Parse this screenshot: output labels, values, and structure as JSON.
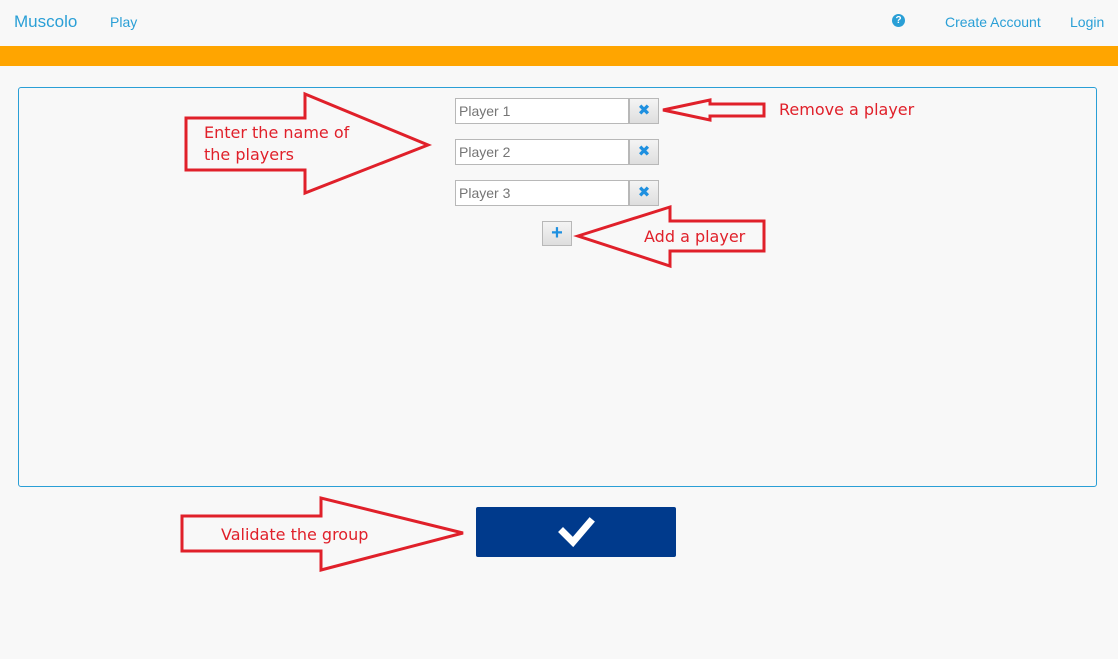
{
  "navbar": {
    "brand": "Muscolo",
    "play": "Play",
    "help_icon": "question-circle-icon",
    "create_account": "Create Account",
    "login": "Login"
  },
  "colors": {
    "accent": "#2a9fd6",
    "orange_bar": "#ffa500",
    "validate_button": "#003a8c",
    "annotation": "#e0202a"
  },
  "players": [
    {
      "placeholder": "Player 1"
    },
    {
      "placeholder": "Player 2"
    },
    {
      "placeholder": "Player 3"
    }
  ],
  "buttons": {
    "remove_icon": "times-icon",
    "add_icon": "plus-icon",
    "validate_icon": "check-icon"
  },
  "annotations": {
    "enter_names_line1": "Enter the name of",
    "enter_names_line2": "the players",
    "remove_player": "Remove a player",
    "add_player": "Add a player",
    "validate_group": "Validate the group"
  }
}
